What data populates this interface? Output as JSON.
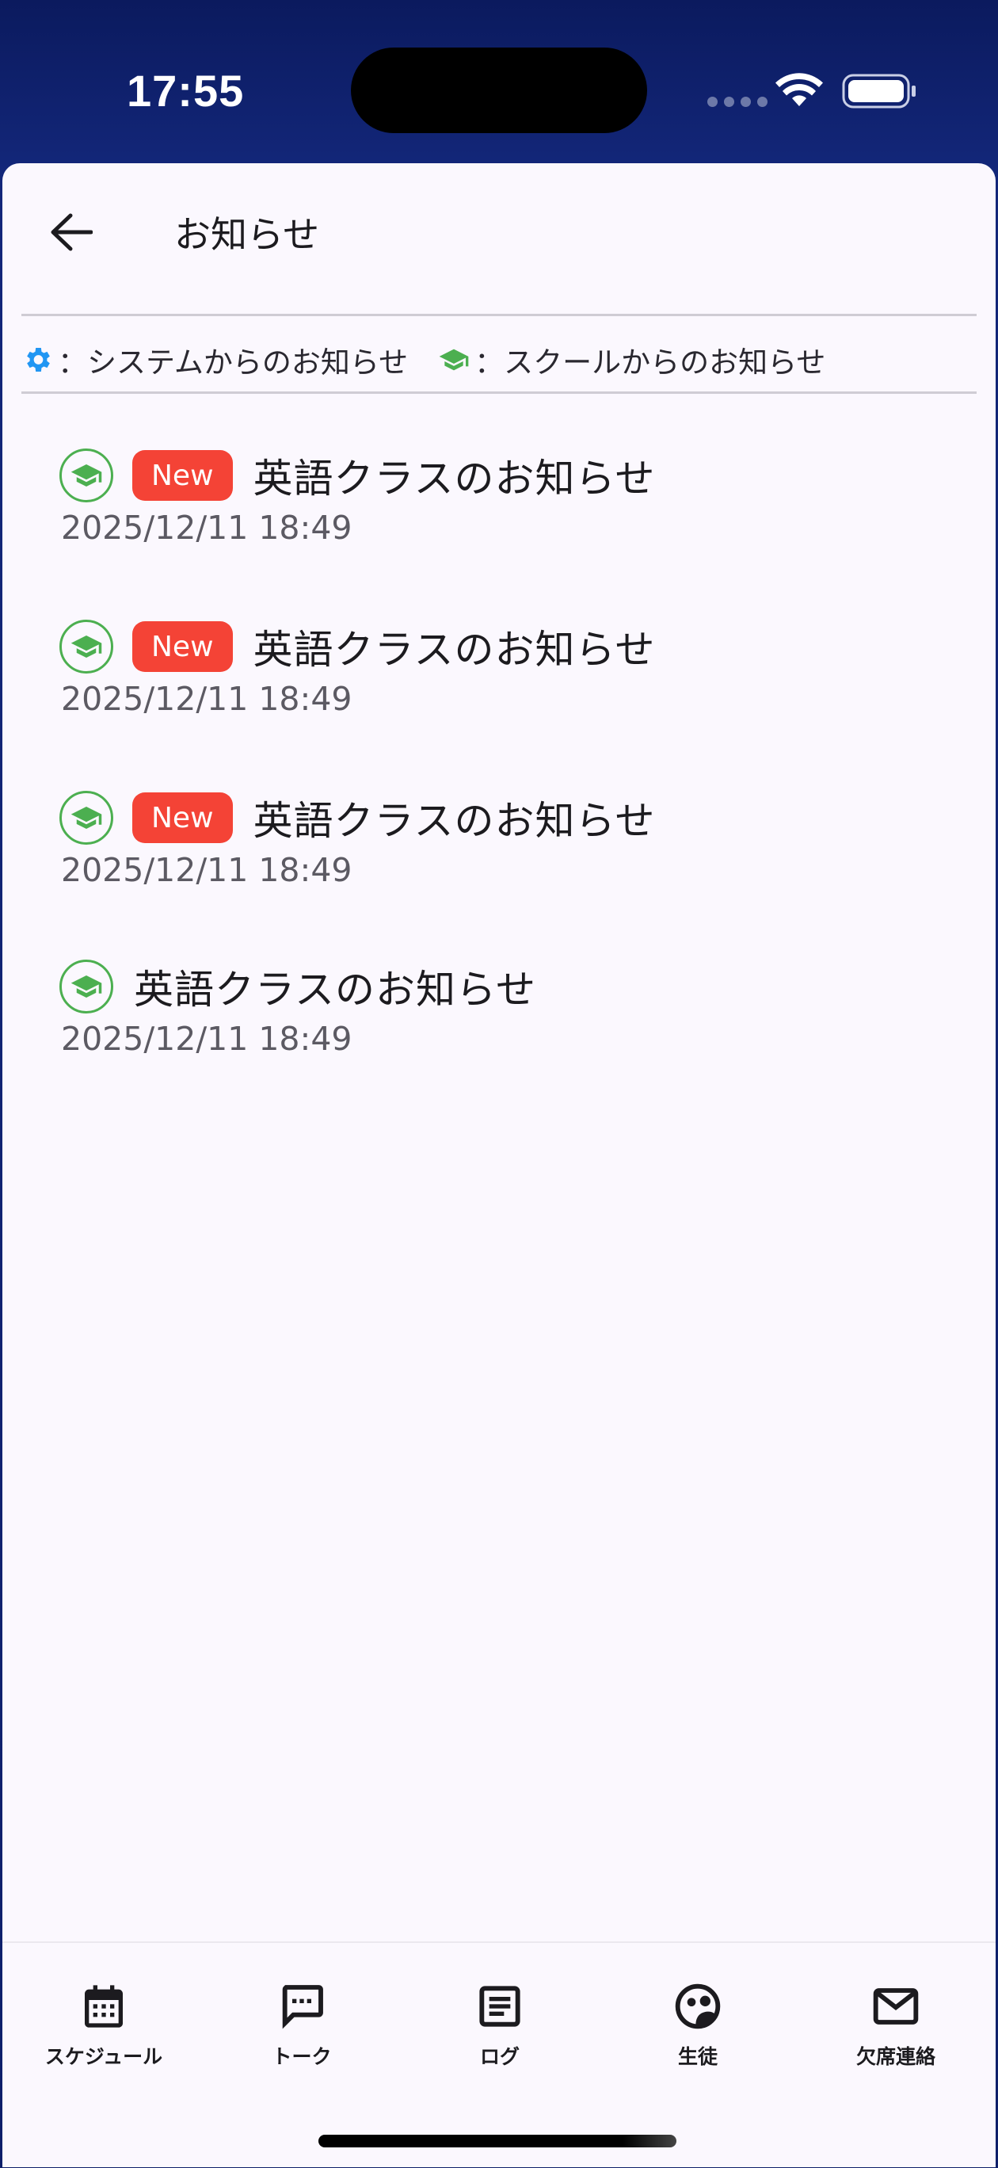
{
  "status_bar": {
    "time": "17:55"
  },
  "header": {
    "title": "お知らせ"
  },
  "legend": {
    "system_label": "：システムからのお知らせ",
    "school_label": "：スクールからのお知らせ"
  },
  "notices": [
    {
      "is_new": true,
      "new_label": "New",
      "title": "英語クラスのお知らせ",
      "date": "2025/12/11 18:49"
    },
    {
      "is_new": true,
      "new_label": "New",
      "title": "英語クラスのお知らせ",
      "date": "2025/12/11 18:49"
    },
    {
      "is_new": true,
      "new_label": "New",
      "title": "英語クラスのお知らせ",
      "date": "2025/12/11 18:49"
    },
    {
      "is_new": false,
      "title": "英語クラスのお知らせ",
      "date": "2025/12/11 18:49"
    }
  ],
  "bottom_nav": {
    "items": [
      {
        "label": "スケジュール",
        "icon": "calendar-icon"
      },
      {
        "label": "トーク",
        "icon": "chat-bubble-icon"
      },
      {
        "label": "ログ",
        "icon": "document-icon"
      },
      {
        "label": "生徒",
        "icon": "student-face-icon"
      },
      {
        "label": "欠席連絡",
        "icon": "mail-icon"
      }
    ]
  },
  "colors": {
    "accent_red": "#f44336",
    "school_green": "#4caf50",
    "system_blue": "#2196f3",
    "header_navy": "#0d1e66"
  }
}
